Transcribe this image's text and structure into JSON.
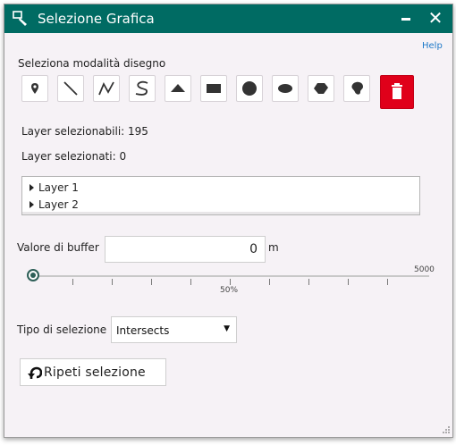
{
  "window": {
    "title": "Selezione Grafica",
    "close_glyph": "✕"
  },
  "help_label": "Help",
  "draw_mode": {
    "label": "Seleziona modalità disegno",
    "tools": [
      "point-icon",
      "line-icon",
      "polyline-icon",
      "freehand-line-icon",
      "triangle-icon",
      "rectangle-icon",
      "circle-icon",
      "ellipse-icon",
      "polygon-icon",
      "freehand-polygon-icon",
      "trash-icon"
    ]
  },
  "layers": {
    "selectable_text": "Layer selezionabili: 195",
    "selected_text": "Layer selezionati: 0",
    "items": [
      "Layer 1",
      "Layer 2"
    ]
  },
  "buffer": {
    "label": "Valore di buffer",
    "value": "0",
    "unit": "m",
    "slider_max_label": "5000",
    "slider_mid_label": "50%",
    "slider_fraction": 0
  },
  "selection_type": {
    "label": "Tipo di selezione",
    "selected": "Intersects"
  },
  "repeat_button_label": "Ripeti selezione",
  "colors": {
    "titlebar": "#006b63",
    "delete_button": "#e0001a",
    "help_link": "#1d78c8"
  }
}
